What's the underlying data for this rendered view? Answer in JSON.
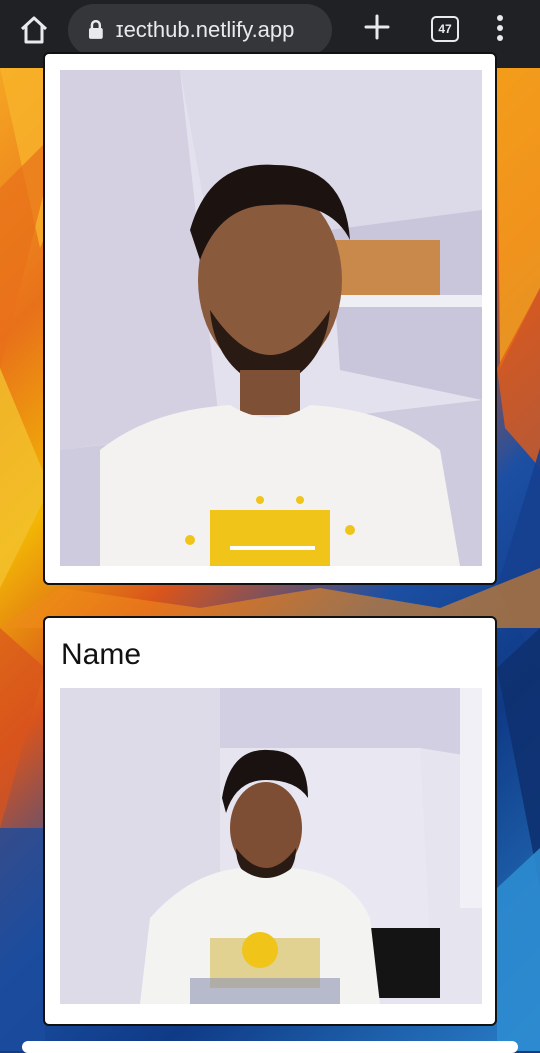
{
  "browser": {
    "url_text": "ɪecthub.netlify.app",
    "tab_count": "47",
    "icons": [
      "home-icon",
      "lock-icon",
      "plus-icon",
      "tabs-icon",
      "more-vert-icon"
    ]
  },
  "cards": [
    {
      "name": "",
      "photo_desc": "video-feed"
    },
    {
      "name": "Name",
      "photo_desc": "video-feed"
    }
  ],
  "colors": {
    "toolbar": "#202124",
    "url_box": "#35363a",
    "card_bg": "#ffffff",
    "card_border": "#111111"
  }
}
